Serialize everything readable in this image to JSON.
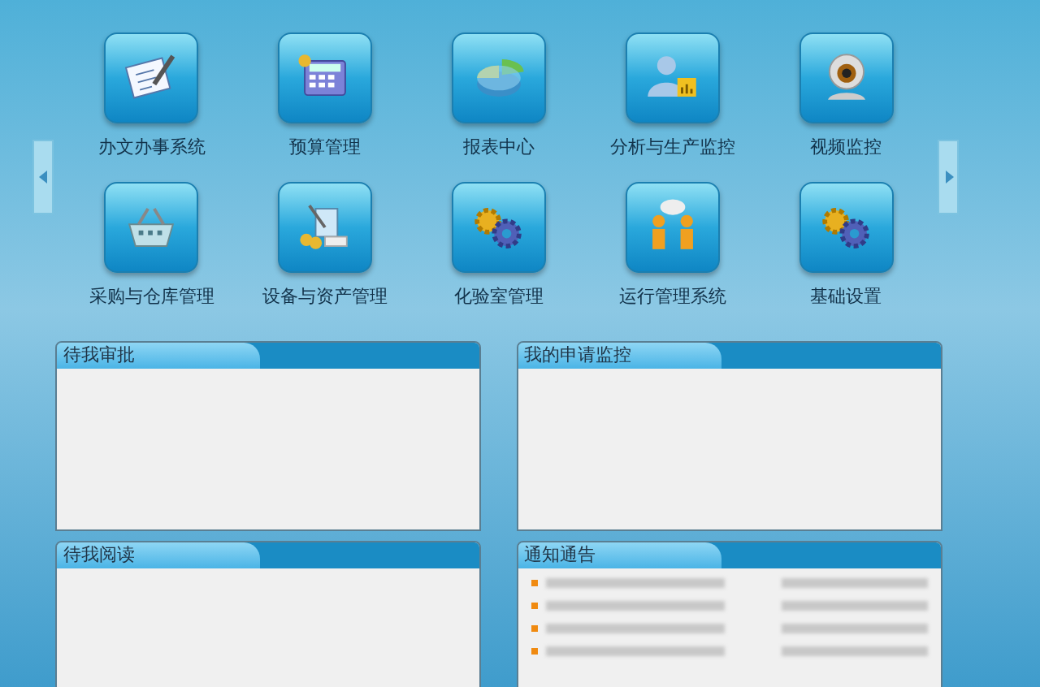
{
  "modules": [
    {
      "label": "办文办事系统"
    },
    {
      "label": "预算管理"
    },
    {
      "label": "报表中心"
    },
    {
      "label": "分析与生产监控"
    },
    {
      "label": "视频监控"
    },
    {
      "label": "采购与仓库管理"
    },
    {
      "label": "设备与资产管理"
    },
    {
      "label": "化验室管理"
    },
    {
      "label": "运行管理系统"
    },
    {
      "label": "基础设置"
    }
  ],
  "panels": [
    {
      "title": "待我审批"
    },
    {
      "title": "我的申请监控"
    },
    {
      "title": "待我阅读"
    },
    {
      "title": "通知通告",
      "items": [
        {
          "kind": "blurred"
        },
        {
          "kind": "blurred"
        },
        {
          "kind": "blurred"
        },
        {
          "kind": "blurred"
        }
      ]
    }
  ]
}
